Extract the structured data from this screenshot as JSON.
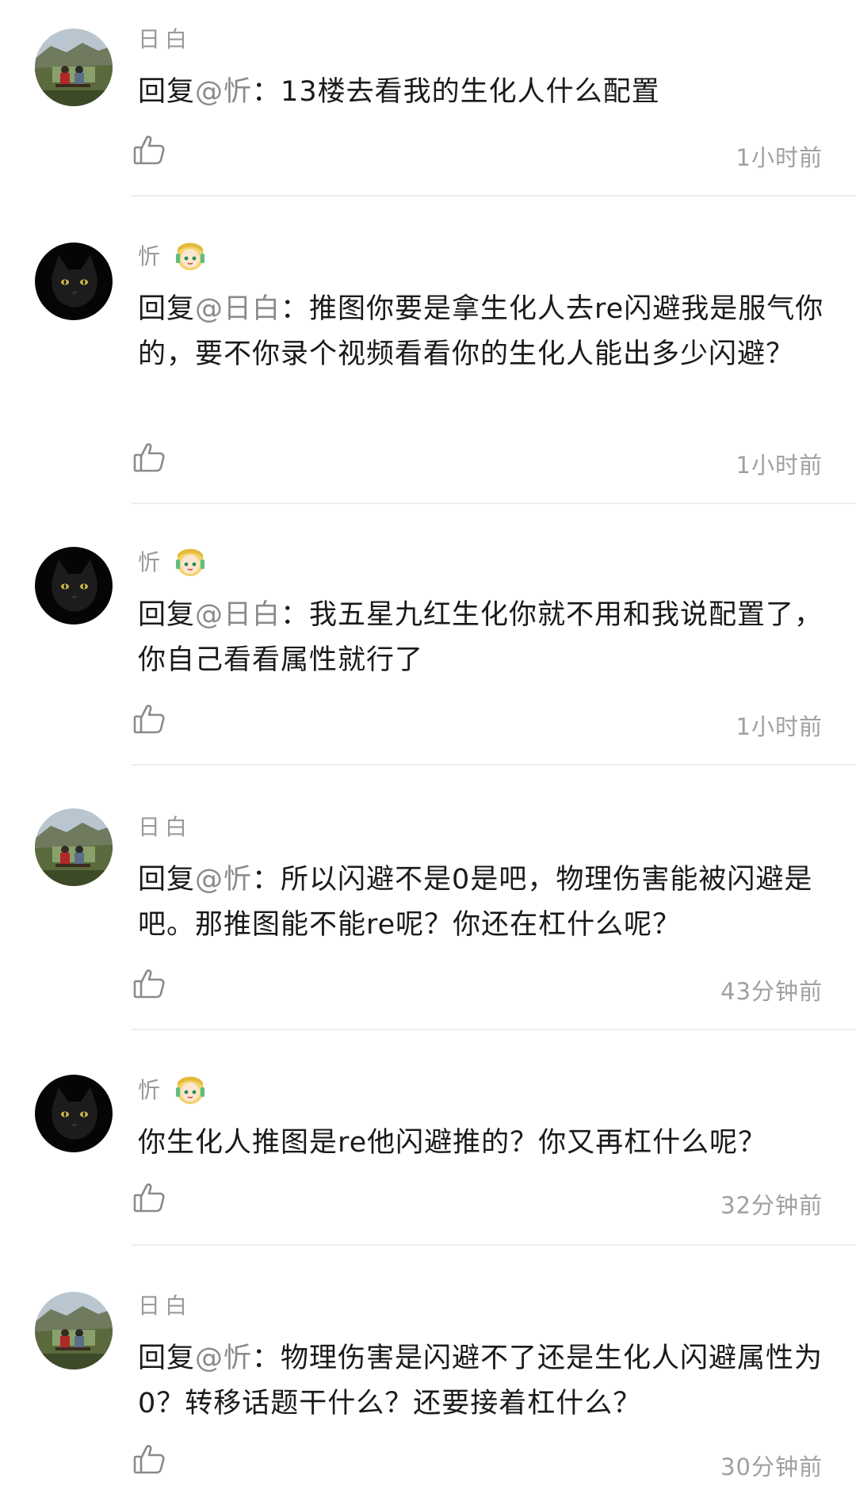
{
  "comments": [
    {
      "username": "日白",
      "avatar": "landscape-avatar",
      "badge": false,
      "reply_prefix": "回复",
      "mention": "@忻",
      "separator": "：",
      "text": "13楼去看我的生化人什么配置",
      "time": "1小时前"
    },
    {
      "username": "忻",
      "avatar": "black-cat-avatar",
      "badge": true,
      "reply_prefix": "回复",
      "mention": "@日白",
      "separator": "：",
      "text": "推图你要是拿生化人去re闪避我是服气你的，要不你录个视频看看你的生化人能出多少闪避？",
      "time": "1小时前"
    },
    {
      "username": "忻",
      "avatar": "black-cat-avatar",
      "badge": true,
      "reply_prefix": "回复",
      "mention": "@日白",
      "separator": "：",
      "text": "我五星九红生化你就不用和我说配置了，你自己看看属性就行了",
      "time": "1小时前"
    },
    {
      "username": "日白",
      "avatar": "landscape-avatar",
      "badge": false,
      "reply_prefix": "回复",
      "mention": "@忻",
      "separator": "：",
      "text": "所以闪避不是0是吧，物理伤害能被闪避是吧。那推图能不能re呢？你还在杠什么呢？",
      "time": "43分钟前"
    },
    {
      "username": "忻",
      "avatar": "black-cat-avatar",
      "badge": true,
      "reply_prefix": "",
      "mention": "",
      "separator": "",
      "text": "你生化人推图是re他闪避推的？你又再杠什么呢？",
      "time": "32分钟前"
    },
    {
      "username": "日白",
      "avatar": "landscape-avatar",
      "badge": false,
      "reply_prefix": "回复",
      "mention": "@忻",
      "separator": "：",
      "text": "物理伤害是闪避不了还是生化人闪避属性为0？转移话题干什么？还要接着杠什么？",
      "time": "30分钟前"
    }
  ],
  "colors": {
    "username": "#9a9a9a",
    "text": "#1a1a1a",
    "time": "#a0a0a0",
    "divider": "#ececec",
    "icon": "#8a8a8a"
  },
  "icons": {
    "like": "thumbs-up-icon",
    "badge": "anime-girl-badge-icon"
  }
}
